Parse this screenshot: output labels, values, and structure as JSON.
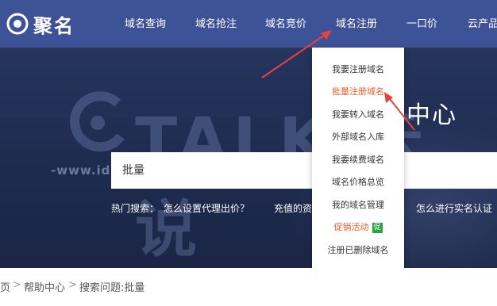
{
  "brand": {
    "logo_text": "聚名",
    "logo_icon": "juming-logo-mark-icon"
  },
  "nav": {
    "items": [
      {
        "label": "域名查询"
      },
      {
        "label": "域名抢注"
      },
      {
        "label": "域名竞价"
      },
      {
        "label": "域名注册"
      },
      {
        "label": "一口价"
      },
      {
        "label": "云产品"
      }
    ]
  },
  "banner": {
    "title": "助中心"
  },
  "watermark": {
    "big_text": "TALK 云说",
    "line_text": "-www.idctalk.com-国内专业云计算交流服务平台-"
  },
  "search": {
    "value": "批量"
  },
  "hot_search": {
    "label": "热门搜索：",
    "item1": "怎么设置代理出价？",
    "item2": "充值的资",
    "item3": "怎么进行实名认证"
  },
  "dropdown": {
    "items": [
      {
        "label": "我要注册域名"
      },
      {
        "label": "批量注册域名"
      },
      {
        "label": "我要转入域名"
      },
      {
        "label": "外部域名入库"
      },
      {
        "label": "我要续费域名"
      },
      {
        "label": "域名价格总览"
      },
      {
        "label": "我的域名管理"
      },
      {
        "label": "促销活动",
        "badge": "促"
      },
      {
        "label": "注册已删除域名"
      }
    ]
  },
  "breadcrumb": {
    "home": "页",
    "sep1": ">",
    "help": "帮助中心",
    "sep2": ">",
    "current": "搜索问题:批量"
  },
  "colors": {
    "header_bg": "#3e5298",
    "banner_bg": "#1e2b4f",
    "accent_orange": "#f15a24",
    "arrow_red": "#e8413e",
    "badge_green": "#2aa33b"
  }
}
